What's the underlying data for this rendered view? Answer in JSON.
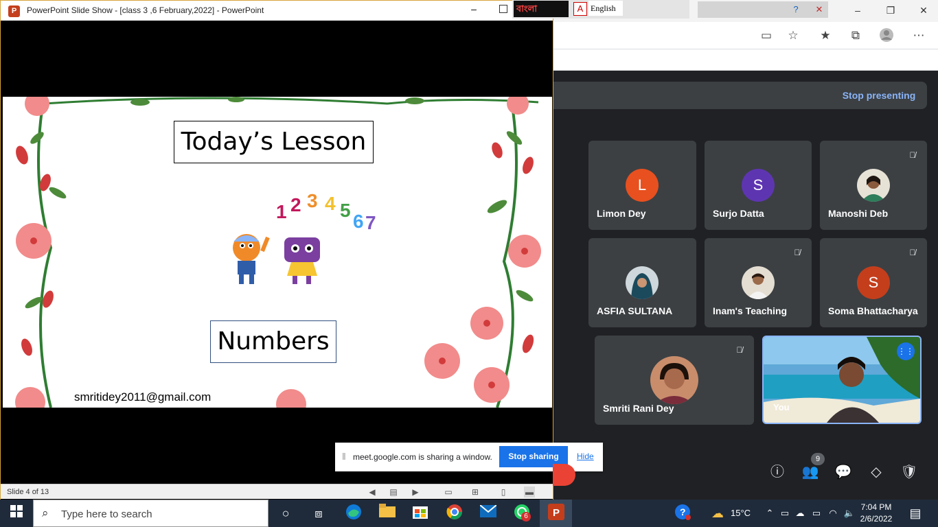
{
  "ppt": {
    "title": "PowerPoint Slide Show - [class 3 ,6 February,2022] - PowerPoint",
    "logo_letter": "P",
    "status": {
      "slide_counter": "Slide 4 of 13"
    },
    "slide": {
      "heading": "Today’s Lesson",
      "subject": "Numbers",
      "digits": [
        "1",
        "2",
        "3",
        "4",
        "5",
        "6",
        "7"
      ],
      "email": "smritidey2011@gmail.com"
    }
  },
  "langbar": {
    "bangla": "বাংলা",
    "english": "English"
  },
  "meet": {
    "stop_presenting": "Stop presenting",
    "participants": [
      {
        "name": "Limon Dey",
        "initial": "L",
        "color": "#e8501f",
        "muted": false
      },
      {
        "name": "Surjo Datta",
        "initial": "S",
        "color": "#5e35b1",
        "muted": false
      },
      {
        "name": "Manoshi Deb",
        "initial": "",
        "color": "#c9b8a8",
        "muted": true
      },
      {
        "name": "ASFIA SULTANA",
        "initial": "",
        "color": "#2b5b73",
        "muted": false
      },
      {
        "name": "Inam's Teaching",
        "initial": "",
        "color": "#d8cfc4",
        "muted": true
      },
      {
        "name": "Soma Bhattacharya",
        "initial": "S",
        "color": "#c43e1c",
        "muted": true
      },
      {
        "name": "Smriti Rani Dey",
        "initial": "",
        "color": "#b06a48",
        "muted": true
      }
    ],
    "self_label": "You",
    "people_count": "9"
  },
  "share_bar": {
    "message": "meet.google.com is sharing a window.",
    "stop_label": "Stop sharing",
    "hide_label": "Hide"
  },
  "taskbar": {
    "search_placeholder": "Type here to search",
    "weather": "15°C",
    "time": "7:04 PM",
    "date": "2/6/2022",
    "whatsapp_badge": "6"
  }
}
